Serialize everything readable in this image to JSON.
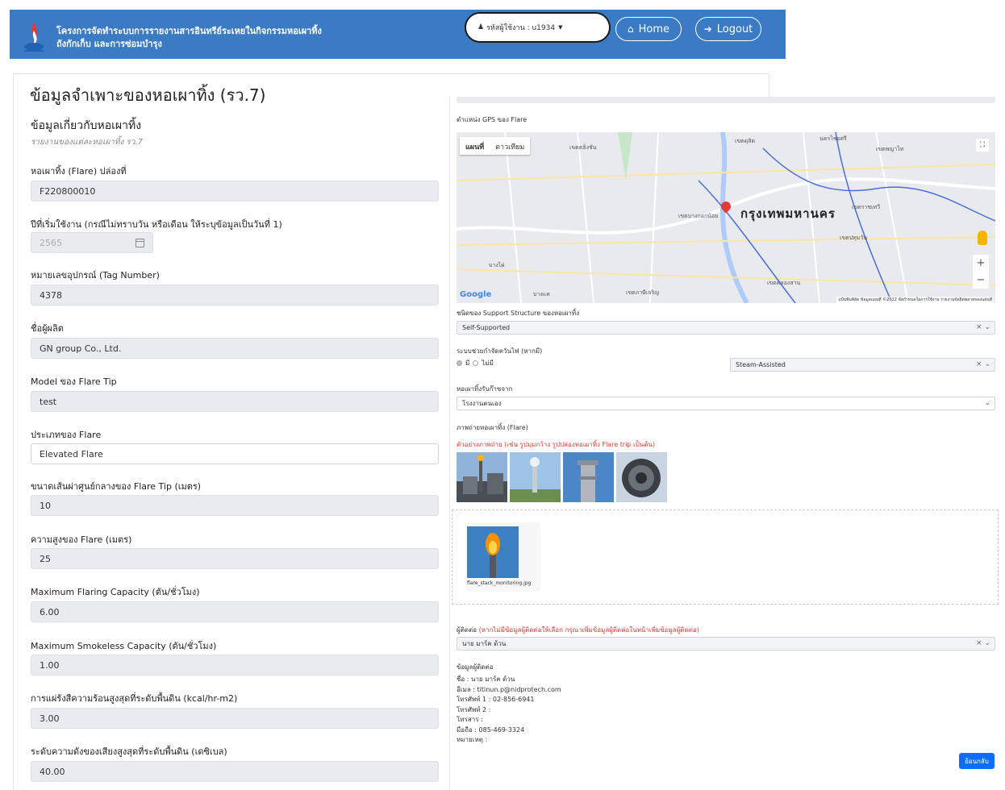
{
  "header": {
    "title_line1": "โครงการจัดทำระบบการรายงานสารอินทรีย์ระเหยในกิจกรรมหอเผาทิ้ง",
    "title_line2": "ถังกักเก็บ และการซ่อมบำรุง",
    "user_label": "รหัสผู้ใช้งาน : u1934",
    "home_label": "Home",
    "logout_label": "Logout"
  },
  "page": {
    "title": "ข้อมูลจำเพาะของหอเผาทิ้ง (รว.7)",
    "section_title": "ข้อมูลเกี่ยวกับหอเผาทิ้ง",
    "section_subtitle": "รายงานของแต่ละหอเผาทิ้ง รว.7"
  },
  "form": {
    "flare_no": {
      "label": "หอเผาทิ้ง (Flare) ปล่องที่",
      "value": "F220800010"
    },
    "start_year": {
      "label": "ปีที่เริ่มใช้งาน (กรณีไม่ทราบวัน หรือเดือน ให้ระบุข้อมูลเป็นวันที่ 1)",
      "value": "2565"
    },
    "tag_number": {
      "label": "หมายเลขอุปกรณ์ (Tag Number)",
      "value": "4378"
    },
    "manufacturer": {
      "label": "ชื่อผู้ผลิต",
      "value": "GN group Co., Ltd."
    },
    "flare_tip_model": {
      "label": "Model ของ Flare Tip",
      "value": "test"
    },
    "flare_type": {
      "label": "ประเภทของ Flare",
      "value": "Elevated Flare"
    },
    "tip_diameter": {
      "label": "ขนาดเส้นผ่าศูนย์กลางของ Flare Tip (เมตร)",
      "value": "10"
    },
    "flare_height": {
      "label": "ความสูงของ Flare (เมตร)",
      "value": "25"
    },
    "max_flaring": {
      "label": "Maximum Flaring Capacity (ตัน/ชั่วโมง)",
      "value": "6.00"
    },
    "max_smokeless": {
      "label": "Maximum Smokeless Capacity (ตัน/ชั่วโมง)",
      "value": "1.00"
    },
    "max_radiation": {
      "label": "การแผ่รังสีความร้อนสูงสุดที่ระดับพื้นดิน (kcal/hr-m2)",
      "value": "3.00"
    },
    "max_noise": {
      "label": "ระดับความดังของเสียงสูงสุดที่ระดับพื้นดิน (เดซิเบล)",
      "value": "40.00"
    }
  },
  "right": {
    "gps_label": "ตำแหน่ง GPS ของ Flare",
    "map": {
      "tab_map": "แผนที่",
      "tab_satellite": "ดาวเทียม",
      "city": "กรุงเทพมหานคร",
      "google": "Google",
      "attribution": "แป้นพิมพ์ลัด  ข้อมูลแผนที่ ©2022  ข้อกำหนดในการใช้งาน  รายงานข้อผิดพลาดของแผนที่",
      "labels": [
        "เขตดุสิต",
        "นครไชยศรี",
        "เขตพญาไท",
        "เขตตลิ่งชัน",
        "เขตบางกอกน้อย",
        "เขตราชเทวี",
        "เขตปทุมวัน",
        "เขตคลองสาน",
        "เขตภาษีเจริญ",
        "บางไผ่",
        "บางแค"
      ]
    },
    "support_label": "ชนิดของ Support Structure ของหอเผาทิ้ง",
    "support_value": "Self-Supported",
    "assist_label": "ระบบช่วยกำจัดควันไฟ (หากมี)",
    "assist_yes": "มี",
    "assist_no": "ไม่มี",
    "assist_value": "Steam-Assisted",
    "source_label": "หอเผาทิ้งรับก๊าซจาก",
    "source_value": "โรงงานตนเอง",
    "photo_label": "ภาพถ่ายหอเผาทิ้ง (Flare)",
    "photo_hint": "ตัวอย่างภาพถ่าย (เช่น รูปมุมกว้าง รูปปล่องหอเผาทิ้ง Flare trip เป็นต้น)",
    "uploaded_file": "flare_stack_monitoring.jpg",
    "contact_label": "ผู้ติดต่อ",
    "contact_hint": "(หากไม่มีข้อมูลผู้ติดต่อให้เลือก กรุณาเพิ่มข้อมูลผู้ติดต่อในหน้าเพิ่มข้อมูลผู้ติดต่อ)",
    "contact_value": "นาย มาร์ค ด้วน",
    "info_title": "ข้อมูลผู้ติดต่อ",
    "info_name": "ชื่อ : นาย มาร์ค ด้วน",
    "info_email": "อีเมล : titinun.p@nidprotech.com",
    "info_phone1": "โทรศัพท์ 1 : 02-856-6941",
    "info_phone2": "โทรศัพท์ 2 :",
    "info_fax": "โทรสาร :",
    "info_mobile": "มือถือ : 085-469-3324",
    "info_note": "หมายเหตุ :",
    "back_label": "ย้อนกลับ"
  },
  "colors": {
    "header_bg": "#3a7bc4",
    "accent": "#0d6efd",
    "hint_red": "#e53935"
  }
}
